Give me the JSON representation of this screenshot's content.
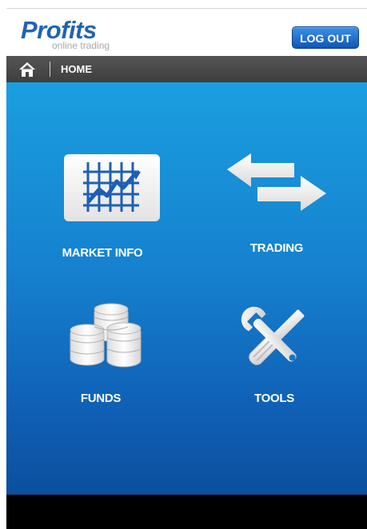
{
  "brand": {
    "title": "Profits",
    "subtitle": "online trading"
  },
  "header": {
    "logout_label": "LOG OUT"
  },
  "nav": {
    "home_icon": "home-icon",
    "breadcrumb": "HOME"
  },
  "menu": {
    "market_info": {
      "label": "MARKET INFO",
      "icon": "chart-icon"
    },
    "trading": {
      "label": "TRADING",
      "icon": "exchange-arrows-icon"
    },
    "funds": {
      "label": "FUNDS",
      "icon": "coins-icon"
    },
    "tools": {
      "label": "TOOLS",
      "icon": "wrench-screwdriver-icon"
    }
  },
  "colors": {
    "brand_blue": "#1f63b5",
    "nav_bg": "#4a4a4a",
    "main_top": "#1a9fe0",
    "main_bottom": "#0c4f9e"
  }
}
